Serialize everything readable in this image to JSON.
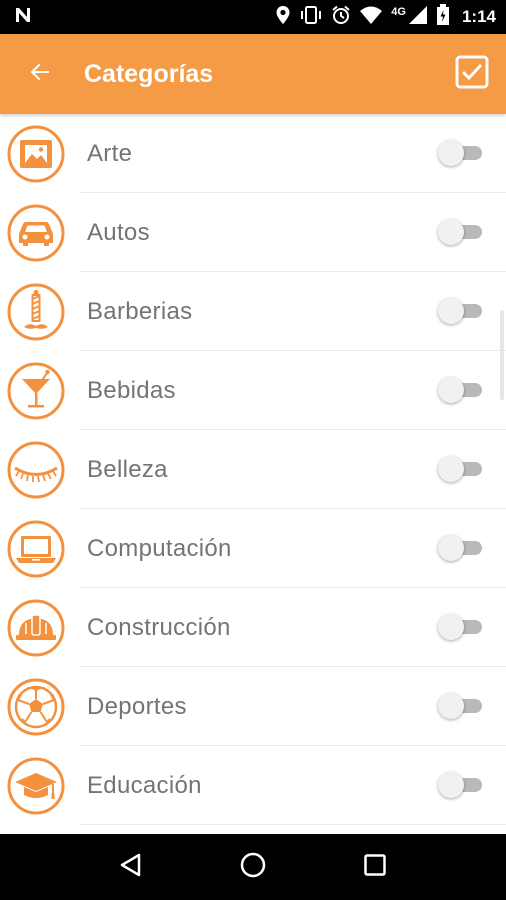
{
  "status_bar": {
    "network_label": "4G",
    "time": "1:14",
    "icons": [
      "notification-n-icon",
      "location-icon",
      "vibrate-icon",
      "alarm-icon",
      "wifi-icon",
      "signal-icon",
      "battery-icon"
    ]
  },
  "app_bar": {
    "title": "Categorías",
    "back_icon": "arrow-back-icon",
    "confirm_icon": "checkbox-checked-icon"
  },
  "categories": [
    {
      "label": "Arte",
      "icon": "picture-frame-icon",
      "enabled": false
    },
    {
      "label": "Autos",
      "icon": "car-icon",
      "enabled": false
    },
    {
      "label": "Barberias",
      "icon": "barber-pole-icon",
      "enabled": false
    },
    {
      "label": "Bebidas",
      "icon": "cocktail-glass-icon",
      "enabled": false
    },
    {
      "label": "Belleza",
      "icon": "eyelash-icon",
      "enabled": false
    },
    {
      "label": "Computación",
      "icon": "laptop-icon",
      "enabled": false
    },
    {
      "label": "Construcción",
      "icon": "hard-hat-icon",
      "enabled": false
    },
    {
      "label": "Deportes",
      "icon": "soccer-ball-icon",
      "enabled": false
    },
    {
      "label": "Educación",
      "icon": "graduation-cap-icon",
      "enabled": false
    }
  ],
  "nav_bar": {
    "icons": [
      "back-triangle-icon",
      "home-circle-icon",
      "recents-square-icon"
    ]
  },
  "colors": {
    "accent": "#F59A45",
    "icon_orange": "#F3913E",
    "label_gray": "#747474",
    "switch_off_track": "#B9B9B9",
    "switch_off_thumb": "#F1F1F1"
  }
}
